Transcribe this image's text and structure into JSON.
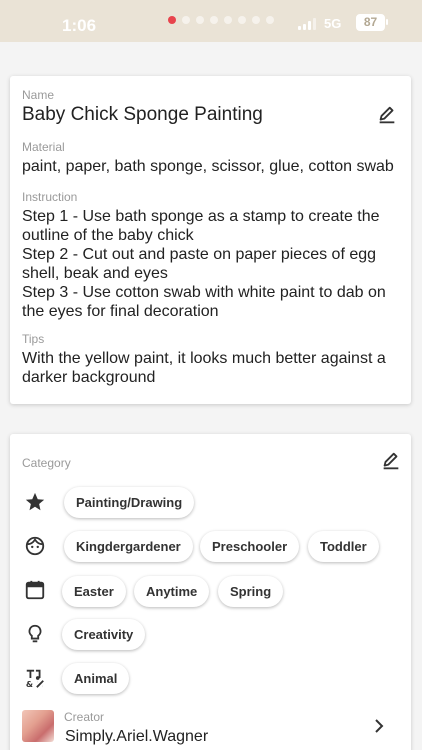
{
  "status_bar": {
    "time": "1:06",
    "network": "5G",
    "battery": "87"
  },
  "details": {
    "name_label": "Name",
    "name": "Baby Chick Sponge Painting",
    "material_label": "Material",
    "material": "paint, paper, bath sponge, scissor, glue, cotton swab",
    "instruction_label": "Instruction",
    "instruction_lines": [
      "Step 1 - Use bath sponge as a stamp to create the",
      "outline of the baby chick",
      "Step 2 - Cut out and paste on paper pieces of egg",
      "shell, beak and eyes",
      "Step 3 - Use cotton swab with white paint to dab on",
      "the eyes for final decoration"
    ],
    "tips_label": "Tips",
    "tips_lines": [
      "With the yellow paint, it looks much better against a",
      "darker background"
    ]
  },
  "category": {
    "label": "Category",
    "rows": [
      {
        "icon": "star-icon",
        "chips": [
          "Painting/Drawing"
        ]
      },
      {
        "icon": "face-icon",
        "chips": [
          "Kingdergardener",
          "Preschooler",
          "Toddler"
        ]
      },
      {
        "icon": "calendar-icon",
        "chips": [
          "Easter",
          "Anytime",
          "Spring"
        ]
      },
      {
        "icon": "lightbulb-icon",
        "chips": [
          "Creativity"
        ]
      },
      {
        "icon": "tags-icon",
        "chips": [
          "Animal"
        ]
      }
    ]
  },
  "creator": {
    "label": "Creator",
    "name": "Simply.Ariel.Wagner"
  }
}
